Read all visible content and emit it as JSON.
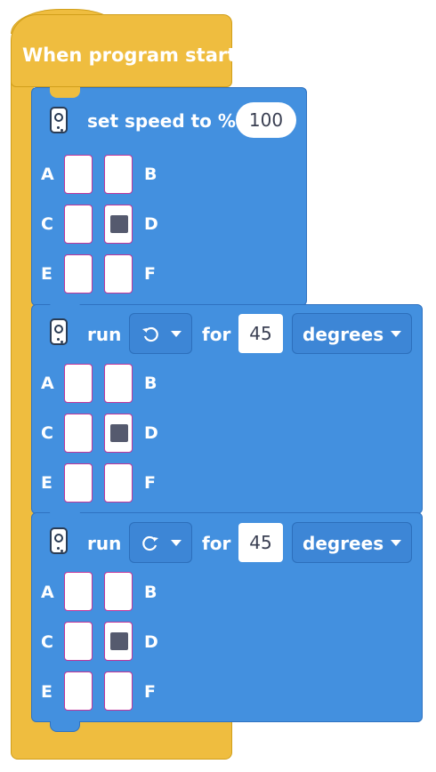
{
  "hat": {
    "title": "When program starts"
  },
  "set_speed": {
    "label": "set speed to %",
    "value": "100",
    "ports": {
      "A": "A",
      "B": "B",
      "C": "C",
      "D": "D",
      "E": "E",
      "F": "F"
    },
    "selected_port": "D"
  },
  "run1": {
    "run_label": "run",
    "direction_icon": "counterclockwise-icon",
    "for_label": "for",
    "amount": "45",
    "unit": "degrees",
    "ports": {
      "A": "A",
      "B": "B",
      "C": "C",
      "D": "D",
      "E": "E",
      "F": "F"
    },
    "selected_port": "D"
  },
  "run2": {
    "run_label": "run",
    "direction_icon": "clockwise-icon",
    "for_label": "for",
    "amount": "45",
    "unit": "degrees",
    "ports": {
      "A": "A",
      "B": "B",
      "C": "C",
      "D": "D",
      "E": "E",
      "F": "F"
    },
    "selected_port": "D"
  },
  "colors": {
    "hat": "#efbd3f",
    "motor_block": "#4390df",
    "selected_port": "#555a6e"
  }
}
